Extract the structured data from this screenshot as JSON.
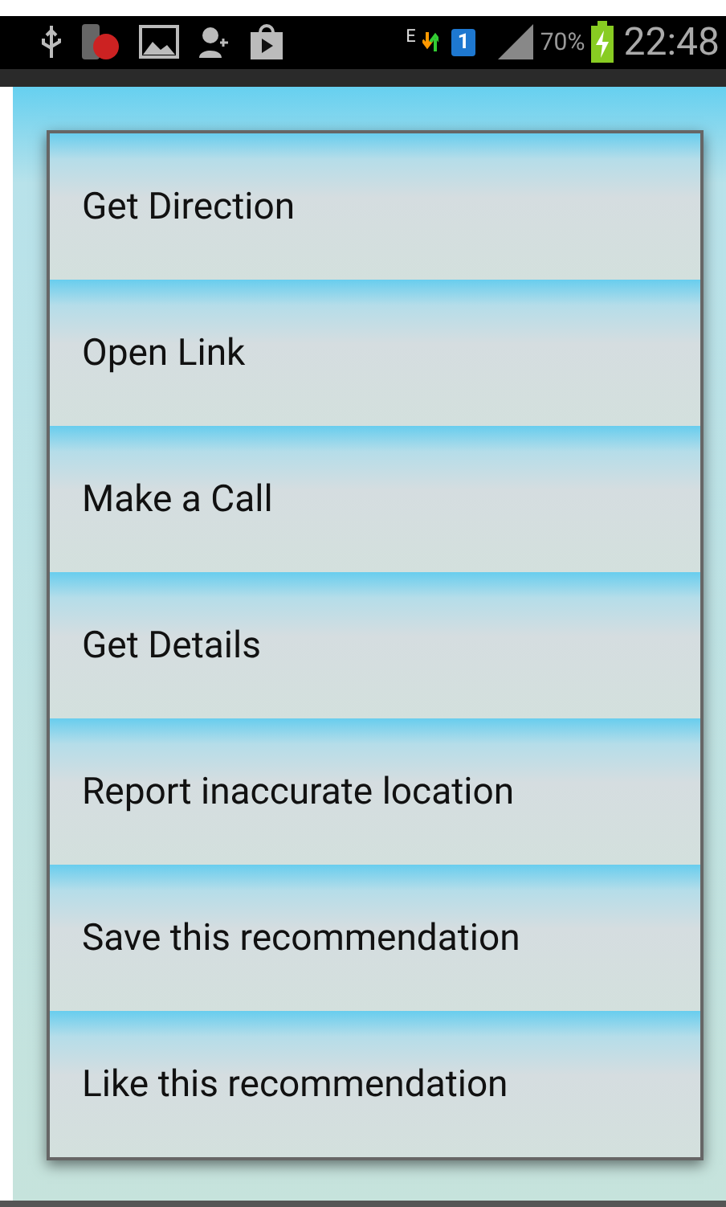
{
  "status_bar": {
    "network": "E",
    "sim": "1",
    "battery": "70%",
    "time": "22:48"
  },
  "menu": {
    "items": [
      {
        "label": "Get Direction"
      },
      {
        "label": "Open Link"
      },
      {
        "label": "Make a Call"
      },
      {
        "label": "Get Details"
      },
      {
        "label": "Report inaccurate location"
      },
      {
        "label": "Save this recommendation"
      },
      {
        "label": "Like this recommendation"
      }
    ]
  }
}
